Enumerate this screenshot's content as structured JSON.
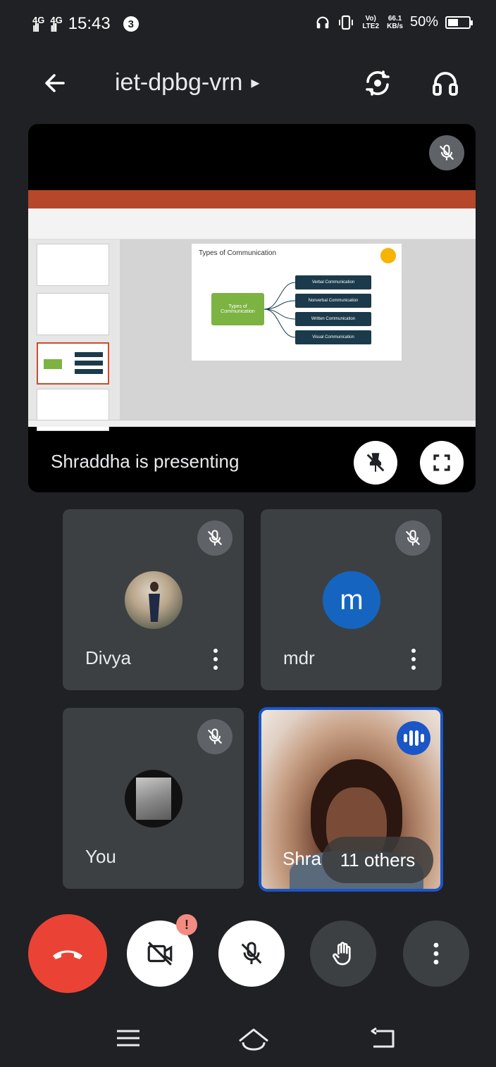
{
  "status_bar": {
    "signal1_label": "4G",
    "signal2_label": "4G",
    "time": "15:43",
    "notification_count": "3",
    "volte_label": "Vo) LTE2",
    "speed_value": "66.1",
    "speed_unit": "KB/s",
    "battery_percent": "50%",
    "battery_level": 0.5
  },
  "header": {
    "meeting_code": "iet-dpbg-vrn",
    "expand_glyph": "▸"
  },
  "presentation": {
    "status_text": "Shraddha is presenting",
    "slide": {
      "title": "Types of Communication",
      "center_label": "Types of Communication",
      "branches": [
        "Verbal Communication",
        "Nonverbal Communication",
        "Written Communication",
        "Visual Communication"
      ]
    }
  },
  "participants": [
    {
      "name": "Divya",
      "initial": "",
      "muted": true
    },
    {
      "name": "mdr",
      "initial": "m",
      "muted": true,
      "avatar_color": "#1565c0"
    },
    {
      "name": "You",
      "initial": "",
      "muted": true
    }
  ],
  "active_speaker": {
    "name": "Shra",
    "others_label": "11 others"
  },
  "controls": {
    "camera_warning": "!",
    "icons": [
      "end-call-icon",
      "camera-off-icon",
      "mic-off-icon",
      "raise-hand-icon",
      "more-vert-icon"
    ]
  },
  "colors": {
    "end_call": "#ea4335",
    "speaker_border": "#1a56c7",
    "tile_bg": "#3c4043",
    "ppt_accent": "#b7472a",
    "slide_center": "#7cb342",
    "slide_box": "#1b3a4b"
  }
}
